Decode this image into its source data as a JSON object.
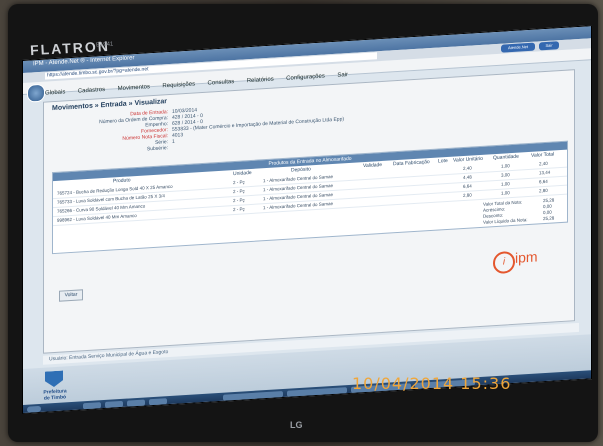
{
  "monitor": {
    "brand": "FLATRON",
    "model": "E1941",
    "maker_logo": "LG"
  },
  "browser": {
    "title": "IPM - Atende.Net ® - Internet Explorer",
    "address": "https://atende.timbo.sc.gov.br/?pg=atende.net"
  },
  "header_buttons": {
    "workspace": "Atende.Net",
    "exit": "Sair"
  },
  "menu": [
    "Globais",
    "Cadastros",
    "Movimentos",
    "Requisições",
    "Consultas",
    "Relatórios",
    "Configurações",
    "Sair"
  ],
  "panel": {
    "title": "Movimentos » Entrada » Visualizar",
    "fields": [
      {
        "label": "Data de Entrada:",
        "value": "10/03/2014"
      },
      {
        "label": "Número da Ordem de Compra:",
        "value": "428 / 2014 - 0"
      },
      {
        "label": "Empenho:",
        "value": "628 / 2014 - 0"
      },
      {
        "label": "Fornecedor:",
        "value": "553833 - (Mater Comércio e Importação de Material de Construção Ltda Epp)"
      },
      {
        "label": "Número Nota Fiscal:",
        "value": "4013"
      },
      {
        "label": "Série:",
        "value": "1"
      },
      {
        "label": "Subsérie:",
        "value": ""
      }
    ]
  },
  "table": {
    "caption": "Produtos da Entrada no Almoxarifado",
    "headers": [
      "Produto",
      "Unidade",
      "Depósito",
      "Validade",
      "Data Fabricação",
      "Lote",
      "Valor Unitário",
      "Quantidade",
      "Valor Total"
    ],
    "rows": [
      {
        "product": "765724 - Bucha de Redução Longa Sold 40 X 25 Amanco",
        "unit": "2 - Pç",
        "deposit": "1 - Almoxarifado Central do Samae",
        "unit_value": "2,40",
        "qty": "1,00",
        "total": "2,40"
      },
      {
        "product": "765733 - Luva Soldável com Bucha de Latão 25 X 3/4",
        "unit": "2 - Pç",
        "deposit": "1 - Almoxarifado Central do Samae",
        "unit_value": "4,48",
        "qty": "3,00",
        "total": "13,44"
      },
      {
        "product": "765266 - Curva 90 Soldável 40 Mm Amanco",
        "unit": "2 - Pç",
        "deposit": "1 - Almoxarifado Central do Samae",
        "unit_value": "6,64",
        "qty": "1,00",
        "total": "6,64"
      },
      {
        "product": "998962 - Luva Soldável 40 Mm Amanco",
        "unit": "2 - Pç",
        "deposit": "1 - Almoxarifado Central do Samae",
        "unit_value": "2,80",
        "qty": "1,00",
        "total": "2,80"
      }
    ],
    "totals": [
      {
        "label": "Valor Total da Nota:",
        "value": "25,28"
      },
      {
        "label": "Acréscimo:",
        "value": "0,00"
      },
      {
        "label": "Desconto:",
        "value": "0,00"
      },
      {
        "label": "Valor Líquido da Nota:",
        "value": "25,28"
      }
    ]
  },
  "back_button": "Voltar",
  "ipm_logo": "ipm",
  "status_bar": "Usuário: Entrada Serviço Municipal de Água e Esgoto",
  "desktop_logo": {
    "line1": "Prefeitura",
    "line2": "de Timbó"
  },
  "photo_timestamp": "10/04/2014 15:36",
  "colors": {
    "accent": "#5f86b1",
    "label_red": "#cc3333",
    "stamp": "#f0a63a"
  }
}
